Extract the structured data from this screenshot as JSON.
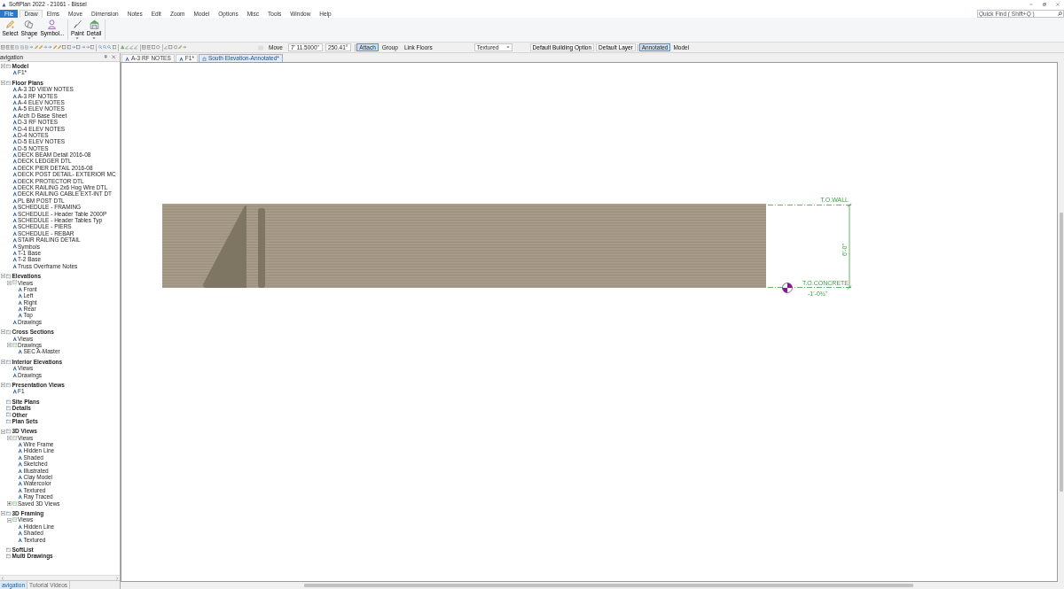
{
  "window": {
    "title": "SoftPlan 2022 - 21061 - Bissel"
  },
  "file_button": "File",
  "menu": [
    {
      "label": "Draw",
      "selected": true
    },
    {
      "label": "Elms",
      "selected": false
    },
    {
      "label": "Move",
      "selected": false
    },
    {
      "label": "Dimension",
      "selected": false
    },
    {
      "label": "Notes",
      "selected": false
    },
    {
      "label": "Edit",
      "selected": false
    },
    {
      "label": "Zoom",
      "selected": false
    },
    {
      "label": "Model",
      "selected": false
    },
    {
      "label": "Options",
      "selected": false
    },
    {
      "label": "Misc",
      "selected": false
    },
    {
      "label": "Tools",
      "selected": false
    },
    {
      "label": "Window",
      "selected": false
    },
    {
      "label": "Help",
      "selected": false
    }
  ],
  "search": {
    "placeholder": "Quick Find ( Shift+Q )"
  },
  "ribbon": [
    {
      "label": "Select",
      "dropdown": false
    },
    {
      "label": "Shape",
      "dropdown": true
    },
    {
      "label": "Symbol...",
      "dropdown": false
    },
    {
      "label": "Paint",
      "dropdown": true
    },
    {
      "label": "Detail",
      "dropdown": true
    }
  ],
  "toolbar": {
    "mode": "Move",
    "length": "7' 11.5000\"",
    "angle": "250.41°",
    "toggles": [
      {
        "label": "Attach",
        "on": true
      },
      {
        "label": "Group",
        "on": false
      },
      {
        "label": "Link Floors",
        "on": false
      }
    ],
    "render_mode": "Textured",
    "building_option": "Default Building Option",
    "layer": "Default Layer",
    "view_modes": [
      {
        "label": "Annotated",
        "selected": true
      },
      {
        "label": "Model",
        "selected": false
      }
    ]
  },
  "navigation": {
    "title": "avigation",
    "tree": [
      {
        "label": "Model",
        "expanded": true,
        "children": [
          {
            "label": "F1*"
          }
        ]
      },
      {
        "label": "Floor Plans",
        "expanded": true,
        "children": [
          {
            "label": "A-3 3D VIEW NOTES"
          },
          {
            "label": "A-3 RF NOTES"
          },
          {
            "label": "A-4 ELEV NOTES"
          },
          {
            "label": "A-5 ELEV NOTES"
          },
          {
            "label": "Arch D Base Sheet"
          },
          {
            "label": "D-3 RF NOTES"
          },
          {
            "label": "D-4 ELEV NOTES"
          },
          {
            "label": "D-4 NOTES"
          },
          {
            "label": "D-5 ELEV NOTES"
          },
          {
            "label": "D-5 NOTES"
          },
          {
            "label": "DECK BEAM Detail 2016-08"
          },
          {
            "label": "DECK LEDGER DTL"
          },
          {
            "label": "DECK PIER DETAIL 2016-08"
          },
          {
            "label": "DECK POST DETAIL- EXTERIOR MC"
          },
          {
            "label": "DECK PROTECTOR DTL"
          },
          {
            "label": "DECK RAILING 2x6 Hog Wire DTL"
          },
          {
            "label": "DECK RAILING CABLE EXT-INT DT"
          },
          {
            "label": "PL BM POST DTL"
          },
          {
            "label": "SCHEDULE - FRAMING"
          },
          {
            "label": "SCHEDULE - Header Table 2000P"
          },
          {
            "label": "SCHEDULE - Header Tables Typ"
          },
          {
            "label": "SCHEDULE - PIERS"
          },
          {
            "label": "SCHEDULE - REBAR"
          },
          {
            "label": "STAIR RAILING DETAIL"
          },
          {
            "label": "Symbols"
          },
          {
            "label": "T-1 Base"
          },
          {
            "label": "T-2 Base"
          },
          {
            "label": "Truss Overframe Notes"
          }
        ]
      },
      {
        "label": "Elevations",
        "expanded": true,
        "children": [
          {
            "label": "Views",
            "expanded": true,
            "children": [
              {
                "label": "Front"
              },
              {
                "label": "Left"
              },
              {
                "label": "Right"
              },
              {
                "label": "Rear"
              },
              {
                "label": "Top"
              }
            ]
          },
          {
            "label": "Drawings"
          }
        ]
      },
      {
        "label": "Cross Sections",
        "expanded": true,
        "children": [
          {
            "label": "Views"
          },
          {
            "label": "Drawings",
            "expanded": true,
            "children": [
              {
                "label": "SEC A-Master"
              }
            ]
          }
        ]
      },
      {
        "label": "Interior Elevations",
        "expanded": true,
        "children": [
          {
            "label": "Views"
          },
          {
            "label": "Drawings"
          }
        ]
      },
      {
        "label": "Presentation Views",
        "expanded": true,
        "children": [
          {
            "label": "F1"
          }
        ]
      },
      {
        "label": "Site Plans"
      },
      {
        "label": "Details"
      },
      {
        "label": "Other"
      },
      {
        "label": "Plan Sets"
      },
      {
        "label": "3D Views",
        "expanded": true,
        "children": [
          {
            "label": "Views",
            "expanded": true,
            "children": [
              {
                "label": "Wire Frame"
              },
              {
                "label": "Hidden Line"
              },
              {
                "label": "Shaded"
              },
              {
                "label": "Sketched"
              },
              {
                "label": "Illustrated"
              },
              {
                "label": "Clay Model"
              },
              {
                "label": "Watercolor"
              },
              {
                "label": "Textured"
              },
              {
                "label": "Ray Traced"
              }
            ]
          },
          {
            "label": "Saved 3D Views",
            "expanded": false
          }
        ]
      },
      {
        "label": "3D Framing",
        "expanded": true,
        "children": [
          {
            "label": "Views",
            "expanded": true,
            "children": [
              {
                "label": "Hidden Line"
              },
              {
                "label": "Shaded"
              },
              {
                "label": "Textured"
              }
            ]
          }
        ]
      },
      {
        "label": "SoftList"
      },
      {
        "label": "Multi Drawings"
      }
    ],
    "tabs": [
      {
        "label": "avigation",
        "selected": true
      },
      {
        "label": "Tutorial Videos",
        "selected": false
      }
    ]
  },
  "document_tabs": [
    {
      "label": "A-3 RF NOTES",
      "selected": false
    },
    {
      "label": "F1*",
      "selected": false
    },
    {
      "label": "South Elevation-Annotated*",
      "selected": true
    }
  ],
  "drawing": {
    "top_label": "T.O.WALL",
    "dimension": "6'-0\"",
    "bottom_label": "T.O.CONCRETE",
    "bottom_elevation": "-1'-0¾\""
  }
}
